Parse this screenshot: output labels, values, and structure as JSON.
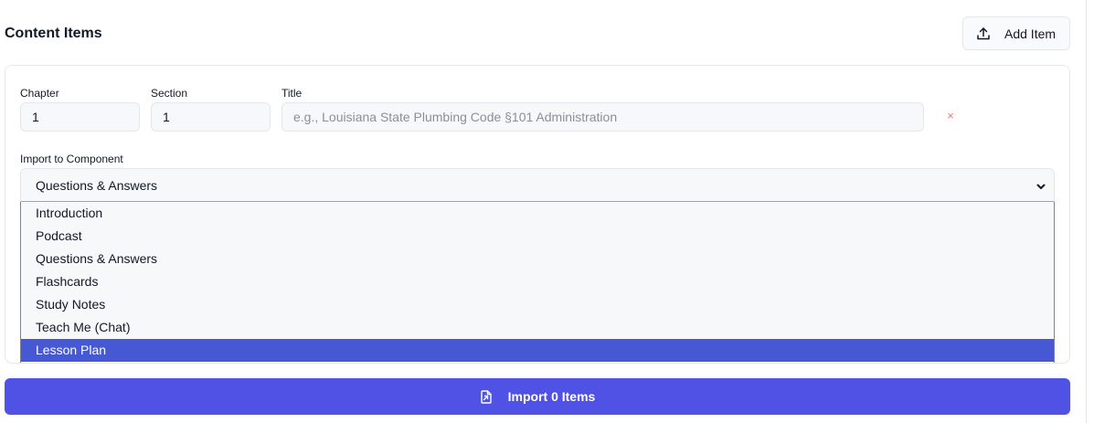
{
  "header": {
    "title": "Content Items",
    "add_button_label": "Add Item",
    "add_icon": "upload-icon"
  },
  "item": {
    "chapter_label": "Chapter",
    "chapter_value": "1",
    "section_label": "Section",
    "section_value": "1",
    "title_label": "Title",
    "title_value": "",
    "title_placeholder": "e.g., Louisiana State Plumbing Code §101 Administration",
    "remove_symbol": "×",
    "component_label": "Import to Component",
    "component_value": "Questions & Answers",
    "component_options": [
      "Introduction",
      "Podcast",
      "Questions & Answers",
      "Flashcards",
      "Study Notes",
      "Teach Me (Chat)",
      "Lesson Plan"
    ],
    "highlighted_option": "Lesson Plan"
  },
  "footer": {
    "import_button_label": "Import 0 Items",
    "import_icon": "file-import-icon"
  },
  "colors": {
    "primary": "#4f52e5",
    "option_highlight": "#4658d4",
    "remove": "#f87171"
  }
}
